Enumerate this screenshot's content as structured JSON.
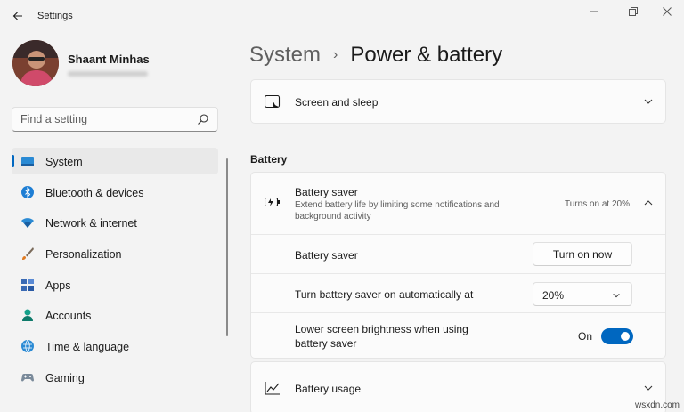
{
  "window": {
    "title": "Settings"
  },
  "profile": {
    "name": "Shaant Minhas"
  },
  "search": {
    "placeholder": "Find a setting"
  },
  "sidebar": {
    "items": [
      {
        "label": "System",
        "icon": "system-icon"
      },
      {
        "label": "Bluetooth & devices",
        "icon": "bluetooth-icon"
      },
      {
        "label": "Network & internet",
        "icon": "network-icon"
      },
      {
        "label": "Personalization",
        "icon": "brush-icon"
      },
      {
        "label": "Apps",
        "icon": "apps-icon"
      },
      {
        "label": "Accounts",
        "icon": "accounts-icon"
      },
      {
        "label": "Time & language",
        "icon": "globe-icon"
      },
      {
        "label": "Gaming",
        "icon": "gaming-icon"
      }
    ]
  },
  "breadcrumb": {
    "parent": "System",
    "separator": "›",
    "current": "Power & battery"
  },
  "screen_sleep": {
    "label": "Screen and sleep"
  },
  "battery_section": {
    "heading": "Battery",
    "saver": {
      "title": "Battery saver",
      "description_line1": "Extend battery life by limiting some notifications and",
      "description_line2": "background activity",
      "status": "Turns on at 20%"
    },
    "saver_row": {
      "label": "Battery saver",
      "button": "Turn on now"
    },
    "auto_row": {
      "label": "Turn battery saver on automatically at",
      "value": "20%"
    },
    "brightness_row": {
      "label_line1": "Lower screen brightness when using",
      "label_line2": "battery saver",
      "state": "On"
    }
  },
  "battery_usage": {
    "label": "Battery usage"
  },
  "watermark": "wsxdn.com",
  "colors": {
    "accent": "#0067c0",
    "background": "#f3f3f3",
    "card": "#fbfbfb"
  }
}
